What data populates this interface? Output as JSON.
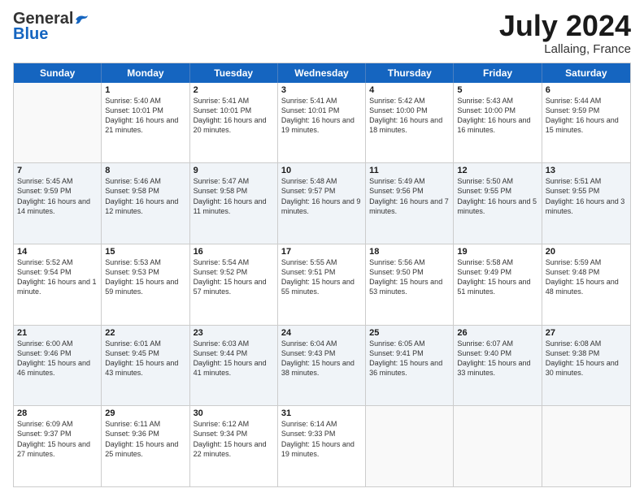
{
  "header": {
    "logo_general": "General",
    "logo_blue": "Blue",
    "month_title": "July 2024",
    "location": "Lallaing, France"
  },
  "weekdays": [
    "Sunday",
    "Monday",
    "Tuesday",
    "Wednesday",
    "Thursday",
    "Friday",
    "Saturday"
  ],
  "rows": [
    [
      {
        "day": "",
        "sunrise": "",
        "sunset": "",
        "daylight": "",
        "empty": true
      },
      {
        "day": "1",
        "sunrise": "Sunrise: 5:40 AM",
        "sunset": "Sunset: 10:01 PM",
        "daylight": "Daylight: 16 hours and 21 minutes."
      },
      {
        "day": "2",
        "sunrise": "Sunrise: 5:41 AM",
        "sunset": "Sunset: 10:01 PM",
        "daylight": "Daylight: 16 hours and 20 minutes."
      },
      {
        "day": "3",
        "sunrise": "Sunrise: 5:41 AM",
        "sunset": "Sunset: 10:01 PM",
        "daylight": "Daylight: 16 hours and 19 minutes."
      },
      {
        "day": "4",
        "sunrise": "Sunrise: 5:42 AM",
        "sunset": "Sunset: 10:00 PM",
        "daylight": "Daylight: 16 hours and 18 minutes."
      },
      {
        "day": "5",
        "sunrise": "Sunrise: 5:43 AM",
        "sunset": "Sunset: 10:00 PM",
        "daylight": "Daylight: 16 hours and 16 minutes."
      },
      {
        "day": "6",
        "sunrise": "Sunrise: 5:44 AM",
        "sunset": "Sunset: 9:59 PM",
        "daylight": "Daylight: 16 hours and 15 minutes."
      }
    ],
    [
      {
        "day": "7",
        "sunrise": "Sunrise: 5:45 AM",
        "sunset": "Sunset: 9:59 PM",
        "daylight": "Daylight: 16 hours and 14 minutes."
      },
      {
        "day": "8",
        "sunrise": "Sunrise: 5:46 AM",
        "sunset": "Sunset: 9:58 PM",
        "daylight": "Daylight: 16 hours and 12 minutes."
      },
      {
        "day": "9",
        "sunrise": "Sunrise: 5:47 AM",
        "sunset": "Sunset: 9:58 PM",
        "daylight": "Daylight: 16 hours and 11 minutes."
      },
      {
        "day": "10",
        "sunrise": "Sunrise: 5:48 AM",
        "sunset": "Sunset: 9:57 PM",
        "daylight": "Daylight: 16 hours and 9 minutes."
      },
      {
        "day": "11",
        "sunrise": "Sunrise: 5:49 AM",
        "sunset": "Sunset: 9:56 PM",
        "daylight": "Daylight: 16 hours and 7 minutes."
      },
      {
        "day": "12",
        "sunrise": "Sunrise: 5:50 AM",
        "sunset": "Sunset: 9:55 PM",
        "daylight": "Daylight: 16 hours and 5 minutes."
      },
      {
        "day": "13",
        "sunrise": "Sunrise: 5:51 AM",
        "sunset": "Sunset: 9:55 PM",
        "daylight": "Daylight: 16 hours and 3 minutes."
      }
    ],
    [
      {
        "day": "14",
        "sunrise": "Sunrise: 5:52 AM",
        "sunset": "Sunset: 9:54 PM",
        "daylight": "Daylight: 16 hours and 1 minute."
      },
      {
        "day": "15",
        "sunrise": "Sunrise: 5:53 AM",
        "sunset": "Sunset: 9:53 PM",
        "daylight": "Daylight: 15 hours and 59 minutes."
      },
      {
        "day": "16",
        "sunrise": "Sunrise: 5:54 AM",
        "sunset": "Sunset: 9:52 PM",
        "daylight": "Daylight: 15 hours and 57 minutes."
      },
      {
        "day": "17",
        "sunrise": "Sunrise: 5:55 AM",
        "sunset": "Sunset: 9:51 PM",
        "daylight": "Daylight: 15 hours and 55 minutes."
      },
      {
        "day": "18",
        "sunrise": "Sunrise: 5:56 AM",
        "sunset": "Sunset: 9:50 PM",
        "daylight": "Daylight: 15 hours and 53 minutes."
      },
      {
        "day": "19",
        "sunrise": "Sunrise: 5:58 AM",
        "sunset": "Sunset: 9:49 PM",
        "daylight": "Daylight: 15 hours and 51 minutes."
      },
      {
        "day": "20",
        "sunrise": "Sunrise: 5:59 AM",
        "sunset": "Sunset: 9:48 PM",
        "daylight": "Daylight: 15 hours and 48 minutes."
      }
    ],
    [
      {
        "day": "21",
        "sunrise": "Sunrise: 6:00 AM",
        "sunset": "Sunset: 9:46 PM",
        "daylight": "Daylight: 15 hours and 46 minutes."
      },
      {
        "day": "22",
        "sunrise": "Sunrise: 6:01 AM",
        "sunset": "Sunset: 9:45 PM",
        "daylight": "Daylight: 15 hours and 43 minutes."
      },
      {
        "day": "23",
        "sunrise": "Sunrise: 6:03 AM",
        "sunset": "Sunset: 9:44 PM",
        "daylight": "Daylight: 15 hours and 41 minutes."
      },
      {
        "day": "24",
        "sunrise": "Sunrise: 6:04 AM",
        "sunset": "Sunset: 9:43 PM",
        "daylight": "Daylight: 15 hours and 38 minutes."
      },
      {
        "day": "25",
        "sunrise": "Sunrise: 6:05 AM",
        "sunset": "Sunset: 9:41 PM",
        "daylight": "Daylight: 15 hours and 36 minutes."
      },
      {
        "day": "26",
        "sunrise": "Sunrise: 6:07 AM",
        "sunset": "Sunset: 9:40 PM",
        "daylight": "Daylight: 15 hours and 33 minutes."
      },
      {
        "day": "27",
        "sunrise": "Sunrise: 6:08 AM",
        "sunset": "Sunset: 9:38 PM",
        "daylight": "Daylight: 15 hours and 30 minutes."
      }
    ],
    [
      {
        "day": "28",
        "sunrise": "Sunrise: 6:09 AM",
        "sunset": "Sunset: 9:37 PM",
        "daylight": "Daylight: 15 hours and 27 minutes."
      },
      {
        "day": "29",
        "sunrise": "Sunrise: 6:11 AM",
        "sunset": "Sunset: 9:36 PM",
        "daylight": "Daylight: 15 hours and 25 minutes."
      },
      {
        "day": "30",
        "sunrise": "Sunrise: 6:12 AM",
        "sunset": "Sunset: 9:34 PM",
        "daylight": "Daylight: 15 hours and 22 minutes."
      },
      {
        "day": "31",
        "sunrise": "Sunrise: 6:14 AM",
        "sunset": "Sunset: 9:33 PM",
        "daylight": "Daylight: 15 hours and 19 minutes."
      },
      {
        "day": "",
        "sunrise": "",
        "sunset": "",
        "daylight": "",
        "empty": true
      },
      {
        "day": "",
        "sunrise": "",
        "sunset": "",
        "daylight": "",
        "empty": true
      },
      {
        "day": "",
        "sunrise": "",
        "sunset": "",
        "daylight": "",
        "empty": true
      }
    ]
  ]
}
